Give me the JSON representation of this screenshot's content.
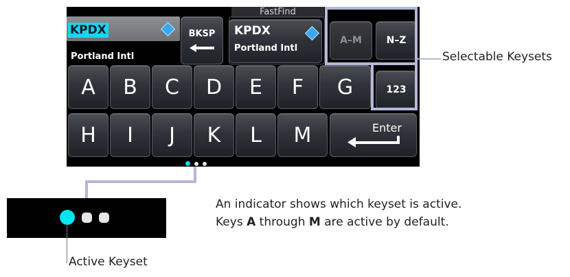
{
  "entry": {
    "value": "KPDX",
    "name": "Portland Intl"
  },
  "backspace": {
    "label": "BKSP"
  },
  "fastfind": {
    "title": "FastFind",
    "value": "KPDX",
    "name": "Portland Intl"
  },
  "keysets": {
    "am": "A–M",
    "nz": "N–Z",
    "num": "123"
  },
  "keys": {
    "row1": [
      "A",
      "B",
      "C",
      "D",
      "E",
      "F",
      "G"
    ],
    "row2": [
      "H",
      "I",
      "J",
      "K",
      "L",
      "M"
    ],
    "enter": "Enter"
  },
  "callouts": {
    "selectable": "Selectable Keysets",
    "indicator_line1": "An indicator shows which keyset is active.",
    "indicator_line2_a": "Keys ",
    "indicator_line2_b": "A",
    "indicator_line2_c": " through ",
    "indicator_line2_d": "M",
    "indicator_line2_e": " are active by default.",
    "active": "Active Keyset"
  },
  "colors": {
    "accent": "#1bd3f0",
    "callout_line": "#b4b8d8"
  }
}
